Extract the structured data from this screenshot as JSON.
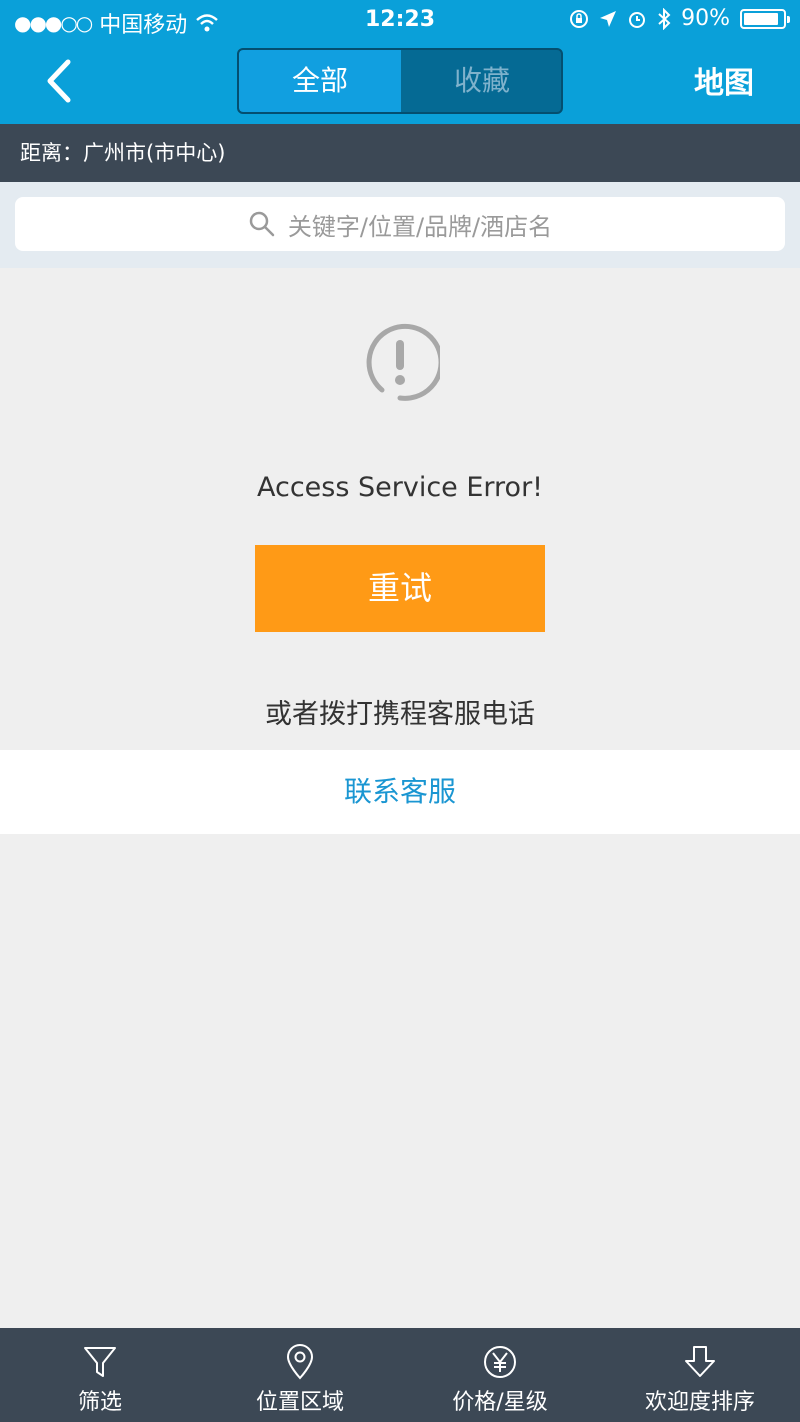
{
  "status_bar": {
    "signal": "●●●○○",
    "carrier": "中国移动",
    "time": "12:23",
    "battery_text": "90%",
    "battery_level": 0.9
  },
  "nav": {
    "tabs": [
      {
        "label": "全部",
        "active": true
      },
      {
        "label": "收藏",
        "active": false
      }
    ],
    "map_label": "地图"
  },
  "location": {
    "text": "距离：广州市(市中心)"
  },
  "search": {
    "placeholder": "关键字/位置/品牌/酒店名"
  },
  "error": {
    "message": "Access Service Error!",
    "retry_label": "重试",
    "alt_text": "或者拨打携程客服电话",
    "contact_label": "联系客服"
  },
  "tabbar": {
    "items": [
      {
        "label": "筛选",
        "icon": "filter-icon"
      },
      {
        "label": "位置区域",
        "icon": "location-pin-icon"
      },
      {
        "label": "价格/星级",
        "icon": "yen-icon"
      },
      {
        "label": "欢迎度排序",
        "icon": "sort-down-icon"
      }
    ]
  },
  "colors": {
    "primary": "#0aa0d9",
    "dark_bar": "#3c4855",
    "accent_orange": "#ff9a16",
    "link_blue": "#1a96d2"
  }
}
